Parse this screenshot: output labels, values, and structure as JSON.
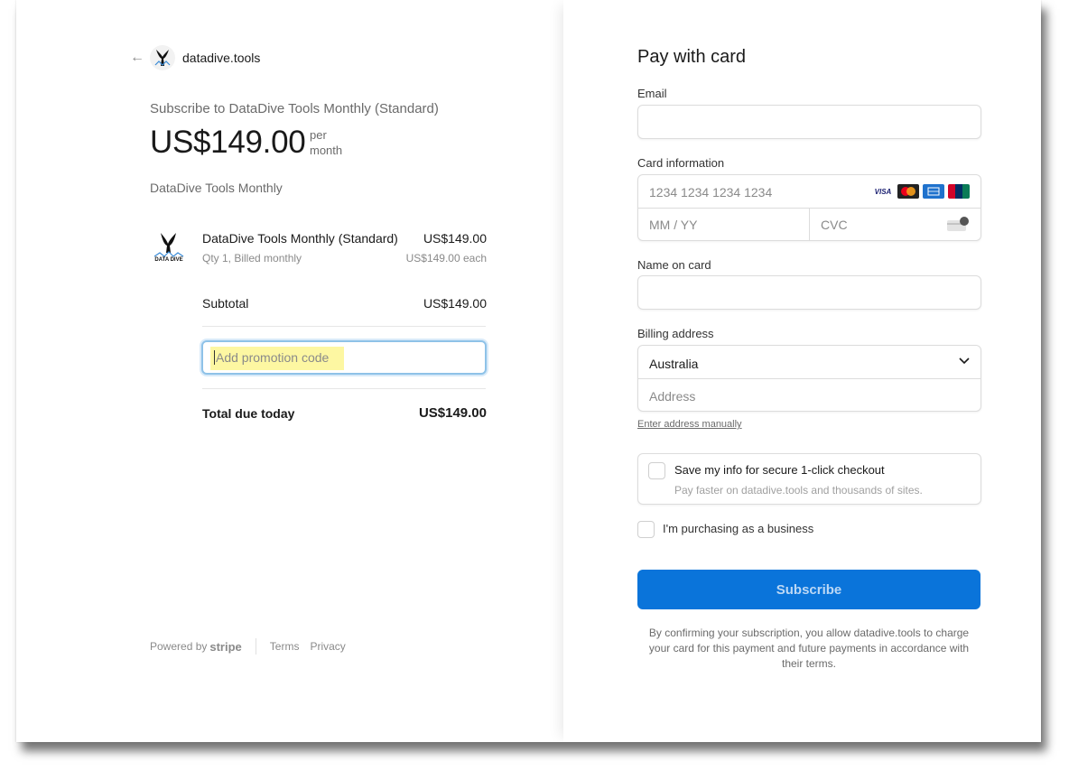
{
  "merchant": {
    "name": "datadive.tools"
  },
  "summary": {
    "heading": "Subscribe to DataDive Tools Monthly (Standard)",
    "price": "US$149.00",
    "per_line1": "per",
    "per_line2": "month",
    "description": "DataDive Tools Monthly"
  },
  "line_item": {
    "logo_text": "DATA DIVE",
    "name": "DataDive Tools Monthly (Standard)",
    "price": "US$149.00",
    "qty": "Qty 1, Billed monthly",
    "each": "US$149.00 each"
  },
  "subtotal": {
    "label": "Subtotal",
    "value": "US$149.00"
  },
  "promo": {
    "placeholder": "Add promotion code"
  },
  "total": {
    "label": "Total due today",
    "value": "US$149.00"
  },
  "footer": {
    "powered_by": "Powered by",
    "brand": "stripe",
    "terms": "Terms",
    "privacy": "Privacy"
  },
  "form": {
    "title": "Pay with card",
    "email_label": "Email",
    "card_label": "Card information",
    "card_number_placeholder": "1234 1234 1234 1234",
    "expiry_placeholder": "MM / YY",
    "cvc_placeholder": "CVC",
    "card_brands": [
      "visa-icon",
      "mastercard-icon",
      "amex-icon",
      "unionpay-icon"
    ],
    "brand_visa": "VISA",
    "name_label": "Name on card",
    "billing_label": "Billing address",
    "country": "Australia",
    "address_placeholder": "Address",
    "enter_manually": "Enter address manually",
    "save_info_title": "Save my info for secure 1-click checkout",
    "save_info_sub": "Pay faster on datadive.tools and thousands of sites.",
    "business_label": "I'm purchasing as a business",
    "subscribe_label": "Subscribe",
    "terms_text": "By confirming your subscription, you allow datadive.tools to charge your card for this payment and future payments in accordance with their terms."
  },
  "colors": {
    "accent": "#0a74da",
    "highlight": "#fdf7a2"
  }
}
